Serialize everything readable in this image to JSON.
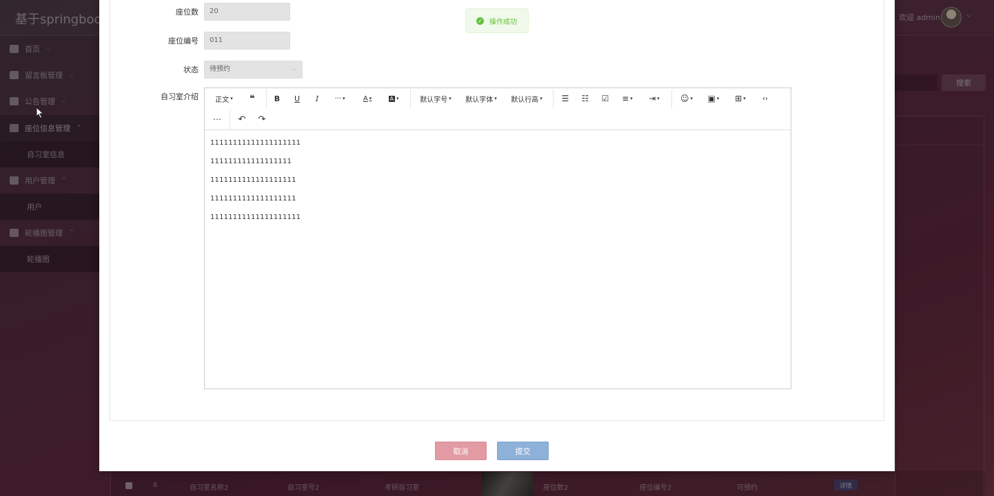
{
  "app": {
    "title": "基于springboot",
    "welcome": "欢迎 admin",
    "avatar_caret": "⌵"
  },
  "sidebar": {
    "items": [
      {
        "label": "首页",
        "caret": "⌵"
      },
      {
        "label": "留言板管理",
        "caret": "⌵"
      },
      {
        "label": "公告管理",
        "caret": "⌵"
      },
      {
        "label": "座位信息管理",
        "caret": "⌃",
        "submenu": "自习室信息"
      },
      {
        "label": "用户管理",
        "caret": "⌃",
        "submenu": "用户"
      },
      {
        "label": "轮播图管理",
        "caret": "⌃",
        "submenu": "轮播图"
      }
    ]
  },
  "background": {
    "search_button": "搜索",
    "row": {
      "index": "6",
      "name": "自习室名称2",
      "number": "自习室号2",
      "type": "考研自习室",
      "seats": "座位数2",
      "seat_code": "座位编号2",
      "status": "可预约",
      "detail": "详情"
    }
  },
  "form": {
    "seats_label": "座位数",
    "seats_value": "20",
    "seat_code_label": "座位编号",
    "seat_code_value": "011",
    "status_label": "状态",
    "status_value": "待预约",
    "intro_label": "自习室介绍"
  },
  "editor": {
    "toolbar": {
      "heading": "正文",
      "quote": "❝",
      "bold": "B",
      "underline": "U",
      "italic": "I",
      "more": "···",
      "font_color": "A",
      "bg_color": "A",
      "font_size": "默认字号",
      "font_family": "默认字体",
      "line_height": "默认行高",
      "bullet_list": "☰",
      "numbered_list": "☷",
      "todo": "☑",
      "align": "≡",
      "indent": "⇥",
      "emoji": "☺",
      "image": "▣",
      "table": "⊞",
      "code": "‹›",
      "divider": "⋯",
      "undo": "↶",
      "redo": "↷",
      "dropdown": "▾"
    },
    "content": [
      "11111111111111111111",
      "111111111111111111",
      "1111111111111111111",
      "1111111111111111111",
      "11111111111111111111"
    ]
  },
  "actions": {
    "cancel": "取消",
    "submit": "提交"
  },
  "toast": {
    "check": "✓",
    "message": "操作成功"
  }
}
